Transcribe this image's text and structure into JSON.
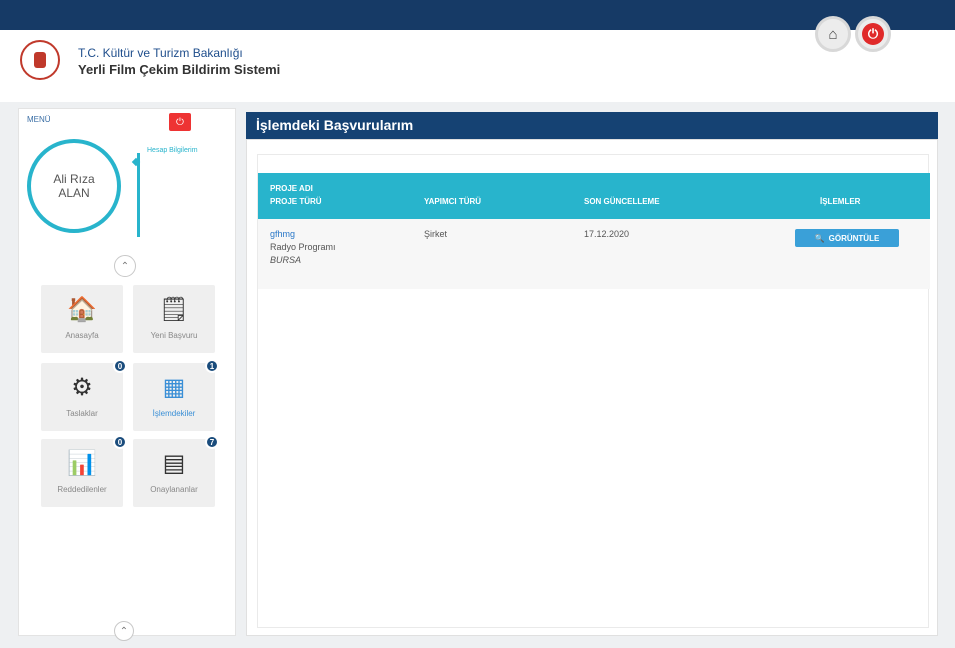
{
  "header": {
    "org_line1": "T.C. Kültür ve Turizm Bakanlığı",
    "org_line2": "Yerli Film Çekim Bildirim Sistemi",
    "home_icon": "home-icon",
    "power_icon": "power-icon"
  },
  "sidebar": {
    "top_label": "MENÜ",
    "logout_icon": "power-icon",
    "user_line1": "Ali Rıza",
    "user_line2": "ALAN",
    "account_link": "Hesap Bilgilerim",
    "tiles": [
      {
        "label": "Anasayfa",
        "icon": "home-icon",
        "badge": ""
      },
      {
        "label": "Yeni Başvuru",
        "icon": "notepad-icon",
        "badge": ""
      },
      {
        "label": "Taslaklar",
        "icon": "gears-icon",
        "badge": "0"
      },
      {
        "label": "İşlemdekiler",
        "icon": "grid-icon",
        "badge": "1"
      },
      {
        "label": "Reddedilenler",
        "icon": "report-icon",
        "badge": "0"
      },
      {
        "label": "Onaylananlar",
        "icon": "binders-icon",
        "badge": "7"
      }
    ]
  },
  "main": {
    "title": "İşlemdeki Başvurularım",
    "table": {
      "headers": {
        "proje_adi": "PROJE ADI",
        "proje_turu": "PROJE TÜRÜ",
        "yapimci_turu": "YAPIMCI TÜRÜ",
        "son_guncelleme": "SON GÜNCELLEME",
        "islemler": "İŞLEMLER"
      },
      "rows": [
        {
          "proje_adi": "gfhmg",
          "proje_turu": "Radyo Programı",
          "city": "BURSA",
          "yapimci_turu": "Şirket",
          "son_guncelleme": "17.12.2020",
          "action": "GÖRÜNTÜLE"
        }
      ]
    }
  },
  "colors": {
    "topbar": "#163a66",
    "accent": "#28b4cc",
    "title_bar": "#154273",
    "button": "#3aa0d8"
  }
}
